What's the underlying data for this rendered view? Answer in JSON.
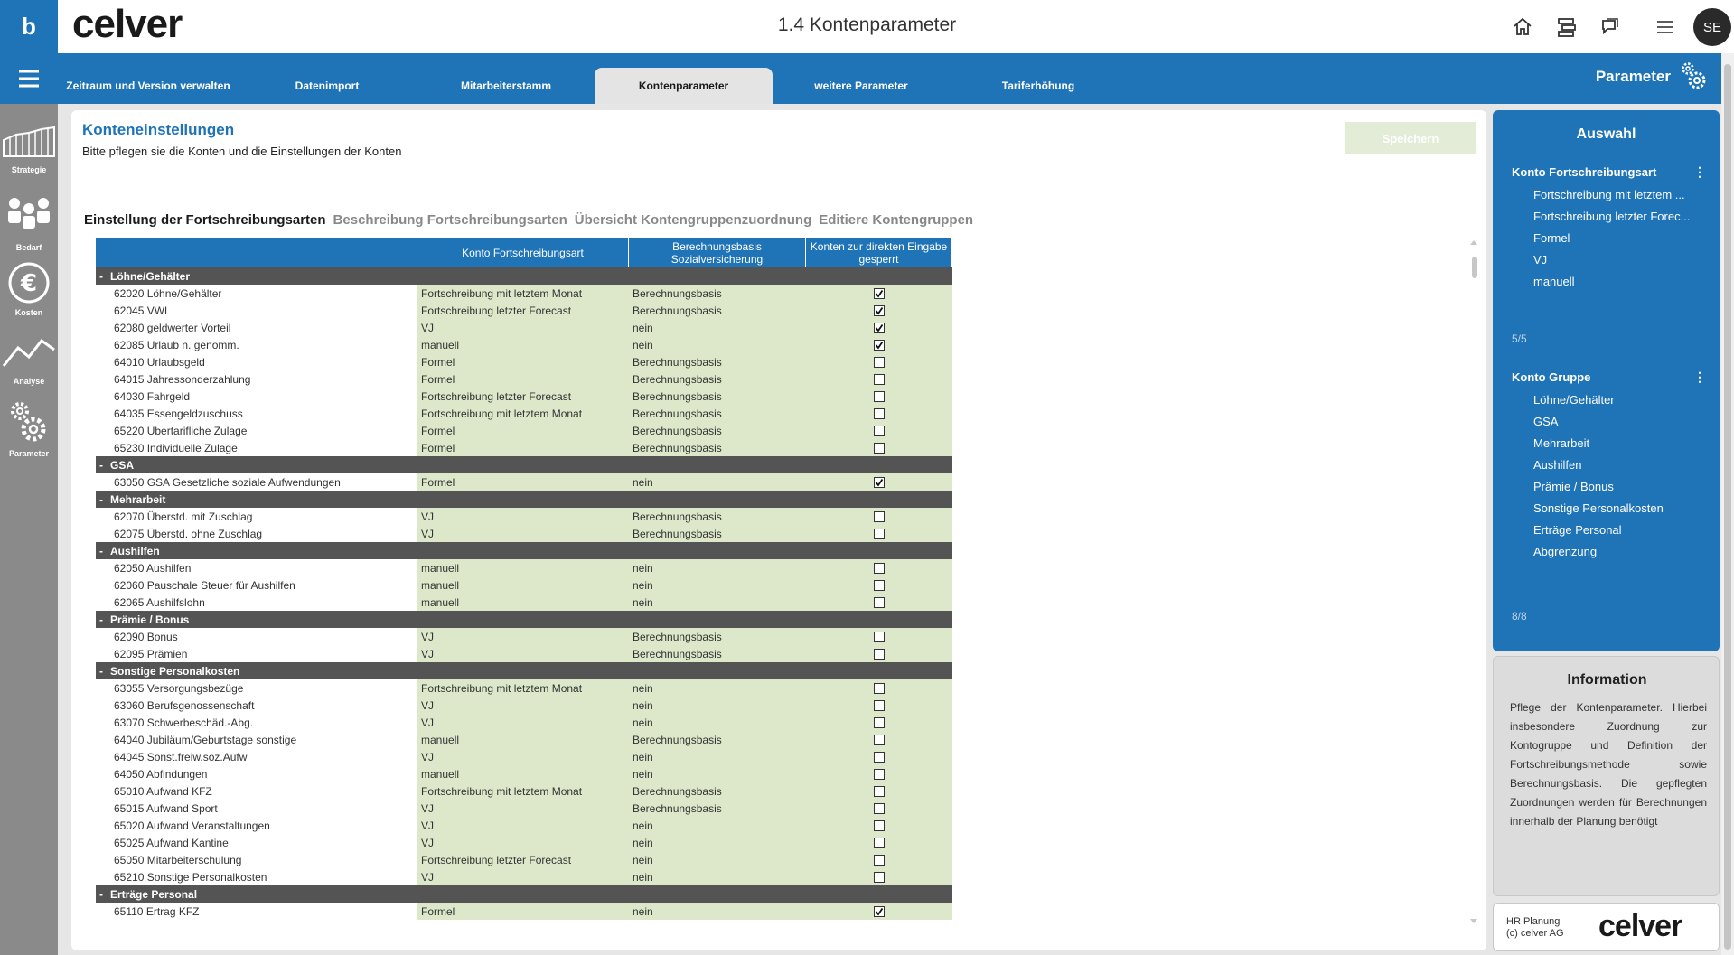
{
  "header": {
    "logo_letter": "b",
    "brand": "celver",
    "title": "1.4 Kontenparameter",
    "avatar_initials": "SE",
    "icons": [
      "home-icon",
      "org-chart-icon",
      "chat-icon",
      "menu-icon"
    ]
  },
  "nav": {
    "tabs": [
      {
        "label": "Zeitraum und Version verwalten",
        "active": false
      },
      {
        "label": "Datenimport",
        "active": false
      },
      {
        "label": "Mitarbeiterstamm",
        "active": false
      },
      {
        "label": "Kontenparameter",
        "active": true
      },
      {
        "label": "weitere Parameter",
        "active": false
      },
      {
        "label": "Tariferhöhung",
        "active": false
      }
    ],
    "right_label": "Parameter"
  },
  "sidebar": {
    "items": [
      {
        "label": "Strategie",
        "icon": "strategy-chart-icon"
      },
      {
        "label": "Bedarf",
        "icon": "people-icon"
      },
      {
        "label": "Kosten",
        "icon": "euro-icon"
      },
      {
        "label": "Analyse",
        "icon": "line-chart-icon"
      },
      {
        "label": "Parameter",
        "icon": "gears-icon"
      }
    ]
  },
  "main": {
    "title": "Konteneinstellungen",
    "subtitle": "Bitte pflegen sie die Konten und die Einstellungen der Konten",
    "save_label": "Speichern",
    "subtabs": [
      {
        "label": "Einstellung der Fortschreibungsarten",
        "active": true
      },
      {
        "label": "Beschreibung Fortschreibungsarten",
        "active": false
      },
      {
        "label": "Übersicht Kontengruppenzuordnung",
        "active": false
      },
      {
        "label": "Editiere Kontengruppen",
        "active": false
      }
    ]
  },
  "table": {
    "headers": [
      "",
      "Konto Fortschreibungsart",
      "Berechnungsbasis Sozialversicherung",
      "Konten zur direkten Eingabe gesperrt"
    ],
    "groups": [
      {
        "name": "Löhne/Gehälter",
        "rows": [
          {
            "account": "62020 Löhne/Gehälter",
            "method": "Fortschreibung mit letztem Monat",
            "basis": "Berechnungsbasis",
            "locked": true
          },
          {
            "account": "62045 VWL",
            "method": "Fortschreibung letzter Forecast",
            "basis": "Berechnungsbasis",
            "locked": true
          },
          {
            "account": "62080 geldwerter Vorteil",
            "method": "VJ",
            "basis": "nein",
            "locked": true
          },
          {
            "account": "62085 Urlaub n. genomm.",
            "method": "manuell",
            "basis": "nein",
            "locked": true
          },
          {
            "account": "64010 Urlaubsgeld",
            "method": "Formel",
            "basis": "Berechnungsbasis",
            "locked": false
          },
          {
            "account": "64015 Jahressonderzahlung",
            "method": "Formel",
            "basis": "Berechnungsbasis",
            "locked": false
          },
          {
            "account": "64030 Fahrgeld",
            "method": "Fortschreibung letzter Forecast",
            "basis": "Berechnungsbasis",
            "locked": false
          },
          {
            "account": "64035 Essengeldzuschuss",
            "method": "Fortschreibung mit letztem Monat",
            "basis": "Berechnungsbasis",
            "locked": false
          },
          {
            "account": "65220 Übertarifliche Zulage",
            "method": "Formel",
            "basis": "Berechnungsbasis",
            "locked": false
          },
          {
            "account": "65230 Individuelle Zulage",
            "method": "Formel",
            "basis": "Berechnungsbasis",
            "locked": false
          }
        ]
      },
      {
        "name": "GSA",
        "rows": [
          {
            "account": "63050 GSA Gesetzliche soziale Aufwendungen",
            "method": "Formel",
            "basis": "nein",
            "locked": true
          }
        ]
      },
      {
        "name": "Mehrarbeit",
        "rows": [
          {
            "account": "62070 Überstd. mit Zuschlag",
            "method": "VJ",
            "basis": "Berechnungsbasis",
            "locked": false
          },
          {
            "account": "62075 Überstd. ohne Zuschlag",
            "method": "VJ",
            "basis": "Berechnungsbasis",
            "locked": false
          }
        ]
      },
      {
        "name": "Aushilfen",
        "rows": [
          {
            "account": "62050 Aushilfen",
            "method": "manuell",
            "basis": "nein",
            "locked": false
          },
          {
            "account": "62060 Pauschale Steuer für Aushilfen",
            "method": "manuell",
            "basis": "nein",
            "locked": false
          },
          {
            "account": "62065 Aushilfslohn",
            "method": "manuell",
            "basis": "nein",
            "locked": false
          }
        ]
      },
      {
        "name": "Prämie / Bonus",
        "rows": [
          {
            "account": "62090 Bonus",
            "method": "VJ",
            "basis": "Berechnungsbasis",
            "locked": false
          },
          {
            "account": "62095 Prämien",
            "method": "VJ",
            "basis": "Berechnungsbasis",
            "locked": false
          }
        ]
      },
      {
        "name": "Sonstige Personalkosten",
        "rows": [
          {
            "account": "63055 Versorgungsbezüge",
            "method": "Fortschreibung mit letztem Monat",
            "basis": "nein",
            "locked": false
          },
          {
            "account": "63060 Berufsgenossenschaft",
            "method": "VJ",
            "basis": "nein",
            "locked": false
          },
          {
            "account": "63070 Schwerbeschäd.-Abg.",
            "method": "VJ",
            "basis": "nein",
            "locked": false
          },
          {
            "account": "64040 Jubiläum/Geburtstage sonstige",
            "method": "manuell",
            "basis": "Berechnungsbasis",
            "locked": false
          },
          {
            "account": "64045 Sonst.freiw.soz.Aufw",
            "method": "VJ",
            "basis": "nein",
            "locked": false
          },
          {
            "account": "64050 Abfindungen",
            "method": "manuell",
            "basis": "nein",
            "locked": false
          },
          {
            "account": "65010 Aufwand KFZ",
            "method": "Fortschreibung mit letztem Monat",
            "basis": "Berechnungsbasis",
            "locked": false
          },
          {
            "account": "65015 Aufwand Sport",
            "method": "VJ",
            "basis": "Berechnungsbasis",
            "locked": false
          },
          {
            "account": "65020 Aufwand Veranstaltungen",
            "method": "VJ",
            "basis": "nein",
            "locked": false
          },
          {
            "account": "65025 Aufwand Kantine",
            "method": "VJ",
            "basis": "nein",
            "locked": false
          },
          {
            "account": "65050 Mitarbeiterschulung",
            "method": "Fortschreibung letzter Forecast",
            "basis": "nein",
            "locked": false
          },
          {
            "account": "65210 Sonstige Personalkosten",
            "method": "VJ",
            "basis": "nein",
            "locked": false
          }
        ]
      },
      {
        "name": "Erträge Personal",
        "rows": [
          {
            "account": "65110 Ertrag KFZ",
            "method": "Formel",
            "basis": "nein",
            "locked": true
          }
        ]
      }
    ]
  },
  "auswahl": {
    "title": "Auswahl",
    "filter1": {
      "heading": "Konto Fortschreibungsart",
      "items": [
        "Fortschreibung mit letztem ...",
        "Fortschreibung letzter Forec...",
        "Formel",
        "VJ",
        "manuell"
      ],
      "count": "5/5"
    },
    "filter2": {
      "heading": "Konto Gruppe",
      "items": [
        "Löhne/Gehälter",
        "GSA",
        "Mehrarbeit",
        "Aushilfen",
        "Prämie / Bonus",
        "Sonstige Personalkosten",
        "Erträge Personal",
        "Abgrenzung"
      ],
      "count": "8/8"
    }
  },
  "info": {
    "title": "Information",
    "text": "Pflege der Kontenparameter. Hierbei insbesondere Zuordnung zur Kontogruppe und Definition der Fortschreibungsmethode sowie Berechnungsbasis. Die gepflegten Zuordnungen werden für Berechnungen innerhalb der Planung benötigt"
  },
  "footer": {
    "line1": "HR Planung",
    "line2": "(c) celver AG",
    "logo": "celver"
  },
  "colors": {
    "primary": "#1f73b7",
    "group_row": "#545454",
    "cell_green": "#dce8c9",
    "sidebar": "#8a8a8a"
  }
}
